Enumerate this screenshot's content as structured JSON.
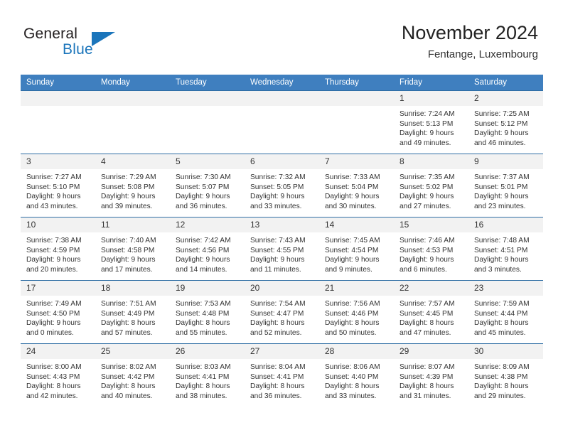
{
  "brand": {
    "word_one": "General",
    "word_two": "Blue",
    "accent_color": "#1b75bb"
  },
  "header": {
    "title": "November 2024",
    "subtitle": "Fentange, Luxembourg",
    "header_bg": "#3f7fbf",
    "daynum_bg": "#f2f2f2"
  },
  "weekday_headers": [
    "Sunday",
    "Monday",
    "Tuesday",
    "Wednesday",
    "Thursday",
    "Friday",
    "Saturday"
  ],
  "labels": {
    "sunrise_prefix": "Sunrise:",
    "sunset_prefix": "Sunset:",
    "daylight_prefix": "Daylight:"
  },
  "weeks": [
    [
      {
        "day": "",
        "empty": true
      },
      {
        "day": "",
        "empty": true
      },
      {
        "day": "",
        "empty": true
      },
      {
        "day": "",
        "empty": true
      },
      {
        "day": "",
        "empty": true
      },
      {
        "day": "1",
        "sunrise": "Sunrise: 7:24 AM",
        "sunset": "Sunset: 5:13 PM",
        "daylight": "Daylight: 9 hours and 49 minutes."
      },
      {
        "day": "2",
        "sunrise": "Sunrise: 7:25 AM",
        "sunset": "Sunset: 5:12 PM",
        "daylight": "Daylight: 9 hours and 46 minutes."
      }
    ],
    [
      {
        "day": "3",
        "sunrise": "Sunrise: 7:27 AM",
        "sunset": "Sunset: 5:10 PM",
        "daylight": "Daylight: 9 hours and 43 minutes."
      },
      {
        "day": "4",
        "sunrise": "Sunrise: 7:29 AM",
        "sunset": "Sunset: 5:08 PM",
        "daylight": "Daylight: 9 hours and 39 minutes."
      },
      {
        "day": "5",
        "sunrise": "Sunrise: 7:30 AM",
        "sunset": "Sunset: 5:07 PM",
        "daylight": "Daylight: 9 hours and 36 minutes."
      },
      {
        "day": "6",
        "sunrise": "Sunrise: 7:32 AM",
        "sunset": "Sunset: 5:05 PM",
        "daylight": "Daylight: 9 hours and 33 minutes."
      },
      {
        "day": "7",
        "sunrise": "Sunrise: 7:33 AM",
        "sunset": "Sunset: 5:04 PM",
        "daylight": "Daylight: 9 hours and 30 minutes."
      },
      {
        "day": "8",
        "sunrise": "Sunrise: 7:35 AM",
        "sunset": "Sunset: 5:02 PM",
        "daylight": "Daylight: 9 hours and 27 minutes."
      },
      {
        "day": "9",
        "sunrise": "Sunrise: 7:37 AM",
        "sunset": "Sunset: 5:01 PM",
        "daylight": "Daylight: 9 hours and 23 minutes."
      }
    ],
    [
      {
        "day": "10",
        "sunrise": "Sunrise: 7:38 AM",
        "sunset": "Sunset: 4:59 PM",
        "daylight": "Daylight: 9 hours and 20 minutes."
      },
      {
        "day": "11",
        "sunrise": "Sunrise: 7:40 AM",
        "sunset": "Sunset: 4:58 PM",
        "daylight": "Daylight: 9 hours and 17 minutes."
      },
      {
        "day": "12",
        "sunrise": "Sunrise: 7:42 AM",
        "sunset": "Sunset: 4:56 PM",
        "daylight": "Daylight: 9 hours and 14 minutes."
      },
      {
        "day": "13",
        "sunrise": "Sunrise: 7:43 AM",
        "sunset": "Sunset: 4:55 PM",
        "daylight": "Daylight: 9 hours and 11 minutes."
      },
      {
        "day": "14",
        "sunrise": "Sunrise: 7:45 AM",
        "sunset": "Sunset: 4:54 PM",
        "daylight": "Daylight: 9 hours and 9 minutes."
      },
      {
        "day": "15",
        "sunrise": "Sunrise: 7:46 AM",
        "sunset": "Sunset: 4:53 PM",
        "daylight": "Daylight: 9 hours and 6 minutes."
      },
      {
        "day": "16",
        "sunrise": "Sunrise: 7:48 AM",
        "sunset": "Sunset: 4:51 PM",
        "daylight": "Daylight: 9 hours and 3 minutes."
      }
    ],
    [
      {
        "day": "17",
        "sunrise": "Sunrise: 7:49 AM",
        "sunset": "Sunset: 4:50 PM",
        "daylight": "Daylight: 9 hours and 0 minutes."
      },
      {
        "day": "18",
        "sunrise": "Sunrise: 7:51 AM",
        "sunset": "Sunset: 4:49 PM",
        "daylight": "Daylight: 8 hours and 57 minutes."
      },
      {
        "day": "19",
        "sunrise": "Sunrise: 7:53 AM",
        "sunset": "Sunset: 4:48 PM",
        "daylight": "Daylight: 8 hours and 55 minutes."
      },
      {
        "day": "20",
        "sunrise": "Sunrise: 7:54 AM",
        "sunset": "Sunset: 4:47 PM",
        "daylight": "Daylight: 8 hours and 52 minutes."
      },
      {
        "day": "21",
        "sunrise": "Sunrise: 7:56 AM",
        "sunset": "Sunset: 4:46 PM",
        "daylight": "Daylight: 8 hours and 50 minutes."
      },
      {
        "day": "22",
        "sunrise": "Sunrise: 7:57 AM",
        "sunset": "Sunset: 4:45 PM",
        "daylight": "Daylight: 8 hours and 47 minutes."
      },
      {
        "day": "23",
        "sunrise": "Sunrise: 7:59 AM",
        "sunset": "Sunset: 4:44 PM",
        "daylight": "Daylight: 8 hours and 45 minutes."
      }
    ],
    [
      {
        "day": "24",
        "sunrise": "Sunrise: 8:00 AM",
        "sunset": "Sunset: 4:43 PM",
        "daylight": "Daylight: 8 hours and 42 minutes."
      },
      {
        "day": "25",
        "sunrise": "Sunrise: 8:02 AM",
        "sunset": "Sunset: 4:42 PM",
        "daylight": "Daylight: 8 hours and 40 minutes."
      },
      {
        "day": "26",
        "sunrise": "Sunrise: 8:03 AM",
        "sunset": "Sunset: 4:41 PM",
        "daylight": "Daylight: 8 hours and 38 minutes."
      },
      {
        "day": "27",
        "sunrise": "Sunrise: 8:04 AM",
        "sunset": "Sunset: 4:41 PM",
        "daylight": "Daylight: 8 hours and 36 minutes."
      },
      {
        "day": "28",
        "sunrise": "Sunrise: 8:06 AM",
        "sunset": "Sunset: 4:40 PM",
        "daylight": "Daylight: 8 hours and 33 minutes."
      },
      {
        "day": "29",
        "sunrise": "Sunrise: 8:07 AM",
        "sunset": "Sunset: 4:39 PM",
        "daylight": "Daylight: 8 hours and 31 minutes."
      },
      {
        "day": "30",
        "sunrise": "Sunrise: 8:09 AM",
        "sunset": "Sunset: 4:38 PM",
        "daylight": "Daylight: 8 hours and 29 minutes."
      }
    ]
  ]
}
